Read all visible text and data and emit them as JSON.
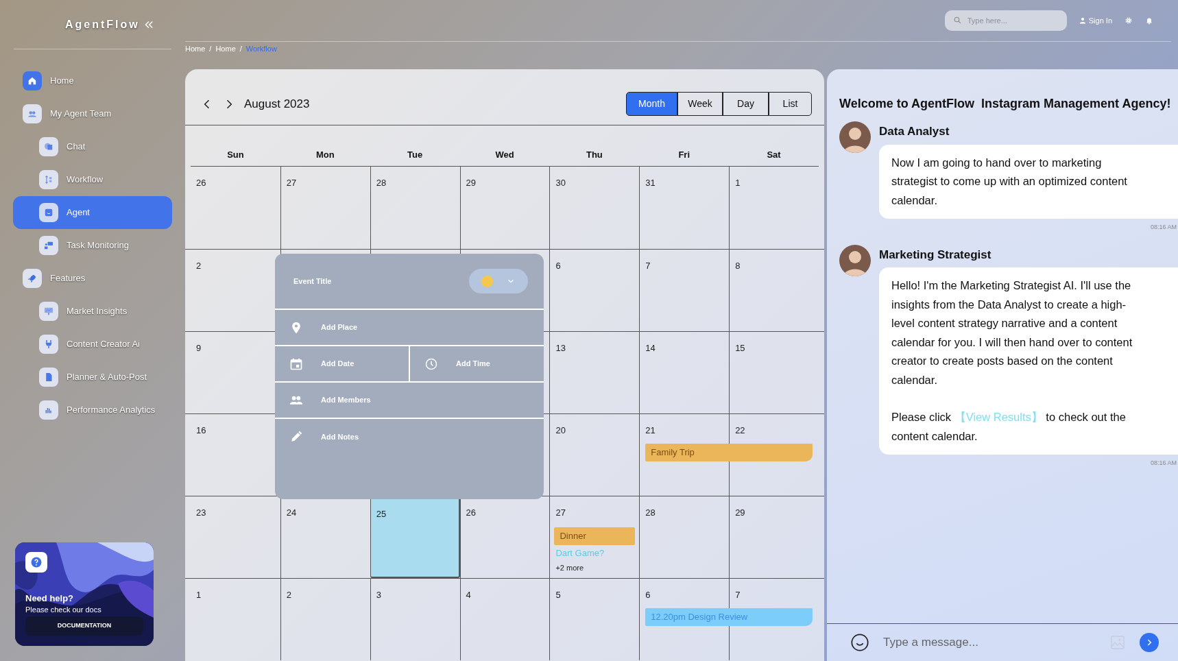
{
  "app": {
    "logo": "AgentFlow"
  },
  "sidebar": {
    "items": [
      {
        "label": "Home",
        "accent": true,
        "selected": false
      },
      {
        "label": "My Agent Team",
        "accent": false,
        "selected": false,
        "children": [
          {
            "label": "Chat",
            "selected": false
          },
          {
            "label": "Workflow",
            "selected": false
          },
          {
            "label": "Agent",
            "selected": true
          },
          {
            "label": "Task Monitoring",
            "selected": false
          }
        ]
      },
      {
        "label": "Features",
        "accent": false,
        "selected": false,
        "children": [
          {
            "label": "Market Insights",
            "selected": false
          },
          {
            "label": "Content Creator Ai",
            "selected": false
          },
          {
            "label": "Planner & Auto-Post",
            "selected": false
          },
          {
            "label": "Performance Analytics",
            "selected": false
          }
        ]
      }
    ]
  },
  "help_card": {
    "title": "Need help?",
    "text": "Please check our docs",
    "button": "DOCUMENTATION"
  },
  "top_bar": {
    "search": {
      "placeholder": "Type here..."
    },
    "sign_in": "Sign In"
  },
  "breadcrumb_separator": "/",
  "breadcrumb": [
    {
      "label": "Home",
      "current": false
    },
    {
      "label": "Home",
      "current": false
    },
    {
      "label": "Workflow",
      "current": true
    }
  ],
  "calendar": {
    "title": "August 2023",
    "views": [
      {
        "label": "Month",
        "selected": true
      },
      {
        "label": "Week",
        "selected": false
      },
      {
        "label": "Day",
        "selected": false
      },
      {
        "label": "List",
        "selected": false
      }
    ],
    "weekdays": [
      "Sun",
      "Mon",
      "Tue",
      "Wed",
      "Thu",
      "Fri",
      "Sat"
    ],
    "weeks": [
      {
        "days": [
          {
            "label": "26",
            "selected": false
          },
          {
            "label": "27",
            "selected": false
          },
          {
            "label": "28",
            "selected": false
          },
          {
            "label": "29",
            "selected": false
          },
          {
            "label": "30",
            "selected": false
          },
          {
            "label": "31",
            "selected": false
          },
          {
            "label": "1",
            "selected": false
          }
        ]
      },
      {
        "days": [
          {
            "label": "2",
            "selected": false
          },
          {
            "label": "6",
            "selected": false
          },
          {
            "label": "7",
            "selected": false
          },
          {
            "label": "8",
            "selected": false
          }
        ]
      },
      {
        "days": [
          {
            "label": "9",
            "selected": false
          },
          {
            "label": "13",
            "selected": false
          },
          {
            "label": "14",
            "selected": false
          },
          {
            "label": "15",
            "selected": false
          }
        ]
      },
      {
        "days": [
          {
            "label": "16",
            "selected": false
          },
          {
            "label": "20",
            "selected": false
          },
          {
            "label": "21",
            "selected": false,
            "events": [
              {
                "kind": "bar",
                "title": "Family Trip",
                "color": "#ebb55a",
                "spans_next": true
              }
            ]
          },
          {
            "label": "22",
            "selected": false
          }
        ]
      },
      {
        "days": [
          {
            "label": "23",
            "selected": false
          },
          {
            "label": "24",
            "selected": false
          },
          {
            "label": "25",
            "selected": true
          },
          {
            "label": "26",
            "selected": false
          },
          {
            "label": "27",
            "selected": false,
            "events": [
              {
                "kind": "bar",
                "title": "Dinner",
                "color": "#ebb55a",
                "spans_next": false
              },
              {
                "kind": "link",
                "title": "Dart Game?",
                "color": "#5cc8f0"
              },
              {
                "kind": "more",
                "title": "+2 more"
              }
            ]
          },
          {
            "label": "28",
            "selected": false
          },
          {
            "label": "29",
            "selected": false
          }
        ]
      },
      {
        "days": [
          {
            "label": "1",
            "selected": false
          },
          {
            "label": "2",
            "selected": false
          },
          {
            "label": "3",
            "selected": false
          },
          {
            "label": "4",
            "selected": false
          },
          {
            "label": "5",
            "selected": false
          },
          {
            "label": "6",
            "selected": false,
            "events": [
              {
                "kind": "bar",
                "title": "12.20pm Design Review",
                "color": "#7dcdfa",
                "spans_next": true
              }
            ]
          },
          {
            "label": "7",
            "selected": false
          }
        ]
      }
    ],
    "event_form": {
      "title": "Event Title",
      "color": "#f5c84c",
      "rows": [
        [
          {
            "kind": "place",
            "label": "Add Place"
          }
        ],
        [
          {
            "kind": "date",
            "label": "Add Date"
          },
          {
            "kind": "time",
            "label": "Add Time"
          }
        ],
        [
          {
            "kind": "members",
            "label": "Add Members"
          }
        ],
        [
          {
            "kind": "notes",
            "label": "Add Notes"
          }
        ]
      ]
    }
  },
  "chat": {
    "title": "Welcome to AgentFlow  Instagram Management Agency!",
    "messages": [
      {
        "sender": "Data Analyst",
        "time": "08:16 AM",
        "body": [
          {
            "kind": "text",
            "text": "Now I am going to hand over to marketing strategist to come up with an optimized content calendar."
          }
        ]
      },
      {
        "sender": "Marketing Strategist",
        "time": "08:16 AM",
        "body": [
          {
            "kind": "text",
            "text": "Hello! I'm the Marketing Strategist AI. I'll use the insights from the Data Analyst to create a high-level content strategy narrative and a content calendar for you. I will then hand over to content creator to create posts based on the content calendar."
          },
          {
            "kind": "link_line",
            "before": "Please click ",
            "link": "【View Results】",
            "after": " to check out the content calendar."
          }
        ]
      }
    ],
    "input": {
      "placeholder": "Type a message..."
    }
  }
}
